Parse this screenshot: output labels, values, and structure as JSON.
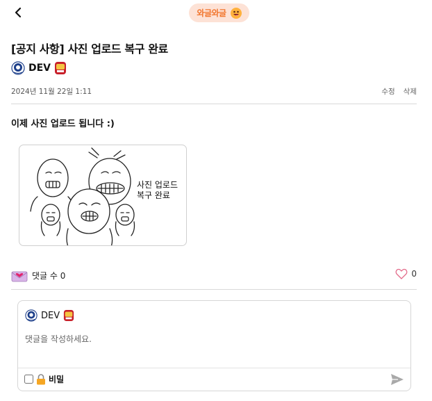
{
  "header": {
    "back_icon": "chevron-left-icon",
    "brand_label": "와글와글",
    "brand_icon": "smiley-face-icon",
    "brand_color": "#f2762e"
  },
  "post": {
    "title": "[공지 사항] 사진 업로드 복구 완료",
    "author": "DEV",
    "date": "2024년 11월 22일 1:11",
    "edit_label": "수정",
    "delete_label": "삭제",
    "body": "이제 사진 업로드 됩니다 :)",
    "image_caption_line1": "사진 업로드",
    "image_caption_line2": "복구 완료"
  },
  "comments": {
    "count_label": "댓글 수 0",
    "like_count": "0",
    "like_icon": "heart-outline-icon"
  },
  "comment_form": {
    "author": "DEV",
    "placeholder": "댓글을 작성하세요.",
    "secret_label": "비밀",
    "send_icon": "paper-plane-icon"
  }
}
